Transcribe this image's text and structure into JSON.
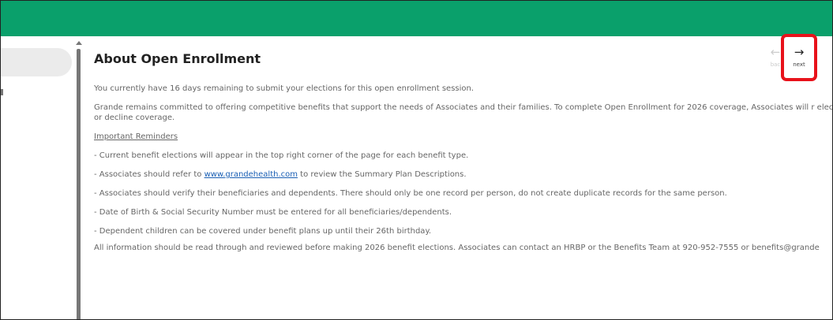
{
  "header": {
    "color": "#0aa06b"
  },
  "sidebar": {
    "active_item_label": ""
  },
  "main": {
    "title": "About Open Enrollment",
    "intro": "You currently have 16 days remaining to submit your elections for this open enrollment session.",
    "commitment": "Grande remains committed to offering competitive benefits that support the needs of Associates and their families. To complete Open Enrollment for 2026 coverage, Associates will r elect or decline coverage.",
    "reminders_heading": "Important Reminders",
    "reminder_1": "- Current benefit elections will appear in the top right corner of the page for each benefit type.",
    "reminder_2_before": "- Associates should refer to ",
    "reminder_2_link": "www.grandehealth.com",
    "reminder_2_after": " to review the Summary Plan Descriptions.",
    "reminder_3": "- Associates should verify their beneficiaries and dependents. There should only be one record per person, do not create duplicate records for the same person.",
    "reminder_4": "- Date of Birth & Social Security Number must be entered for all beneficiaries/dependents.",
    "reminder_5": "- Dependent children can be covered under benefit plans up until their 26th birthday.",
    "closing": "All information should be read through and reviewed before making 2026 benefit elections. Associates can contact an HRBP or the Benefits Team at 920-952-7555 or benefits@grande"
  },
  "nav": {
    "back": {
      "icon": "arrow-left-icon",
      "label": "bac"
    },
    "next": {
      "icon": "arrow-right-icon",
      "label": "next"
    },
    "extra": {
      "icon": "arrow-right-icon",
      "label": ""
    }
  },
  "highlight": {
    "color": "#e8121b"
  }
}
